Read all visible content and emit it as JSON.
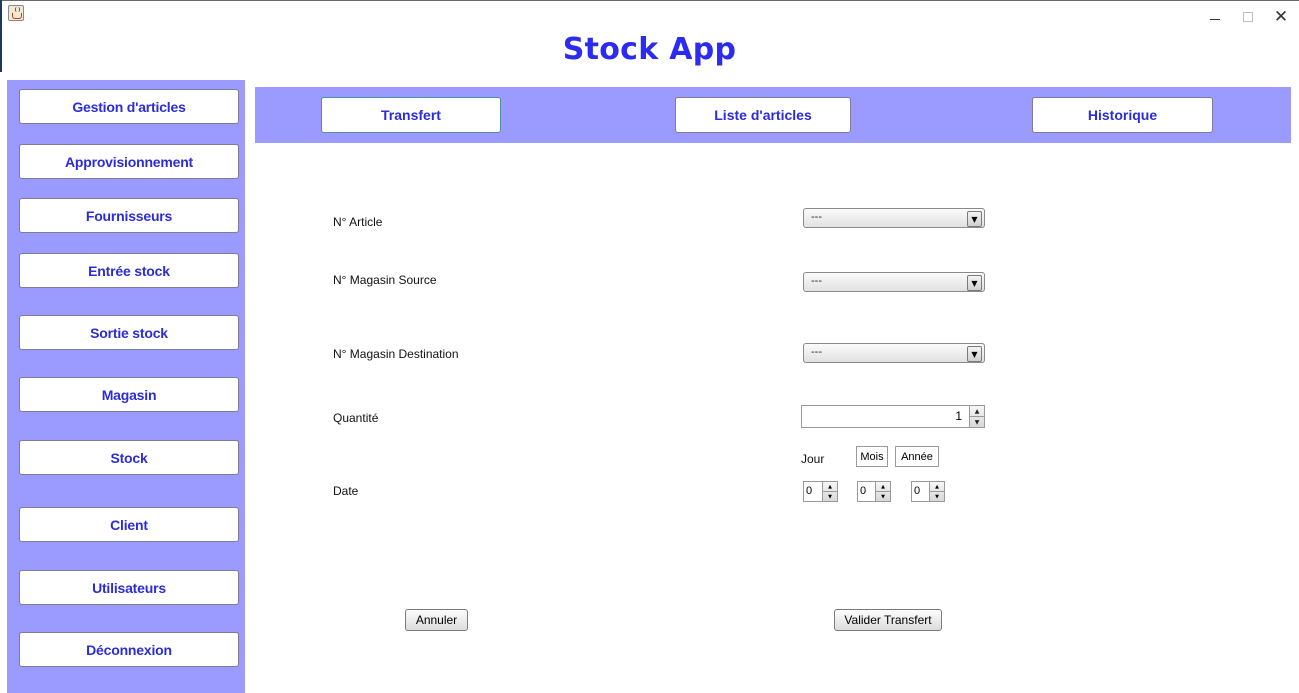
{
  "window": {
    "title": "Stock App",
    "icon": "java-cup-icon",
    "controls": {
      "minimize": "minimize-icon",
      "maximize": "maximize-icon",
      "close": "✕"
    }
  },
  "colors": {
    "accent": "#9a9aff",
    "title": "#2b2bf2",
    "button_text": "#2c2cd8"
  },
  "sidebar": {
    "items": [
      {
        "label": "Gestion d'articles"
      },
      {
        "label": "Approvisionnement"
      },
      {
        "label": "Fournisseurs"
      },
      {
        "label": "Entrée stock"
      },
      {
        "label": "Sortie stock"
      },
      {
        "label": "Magasin"
      },
      {
        "label": "Stock"
      },
      {
        "label": "Client"
      },
      {
        "label": "Utilisateurs"
      },
      {
        "label": "Déconnexion"
      }
    ]
  },
  "tabs": [
    {
      "label": "Transfert"
    },
    {
      "label": "Liste d'articles"
    },
    {
      "label": "Historique"
    }
  ],
  "form": {
    "article": {
      "label": "N° Article",
      "value": "---"
    },
    "source": {
      "label": "N° Magasin Source",
      "value": "---"
    },
    "destination": {
      "label": "N° Magasin Destination",
      "value": "---"
    },
    "quantity": {
      "label": "Quantité",
      "value": "1"
    },
    "date": {
      "label": "Date",
      "day_label": "Jour",
      "month_label": "Mois",
      "year_label": "Année",
      "day": "0",
      "month": "0",
      "year": "0"
    },
    "cancel_label": "Annuler",
    "submit_label": "Valider Transfert"
  }
}
